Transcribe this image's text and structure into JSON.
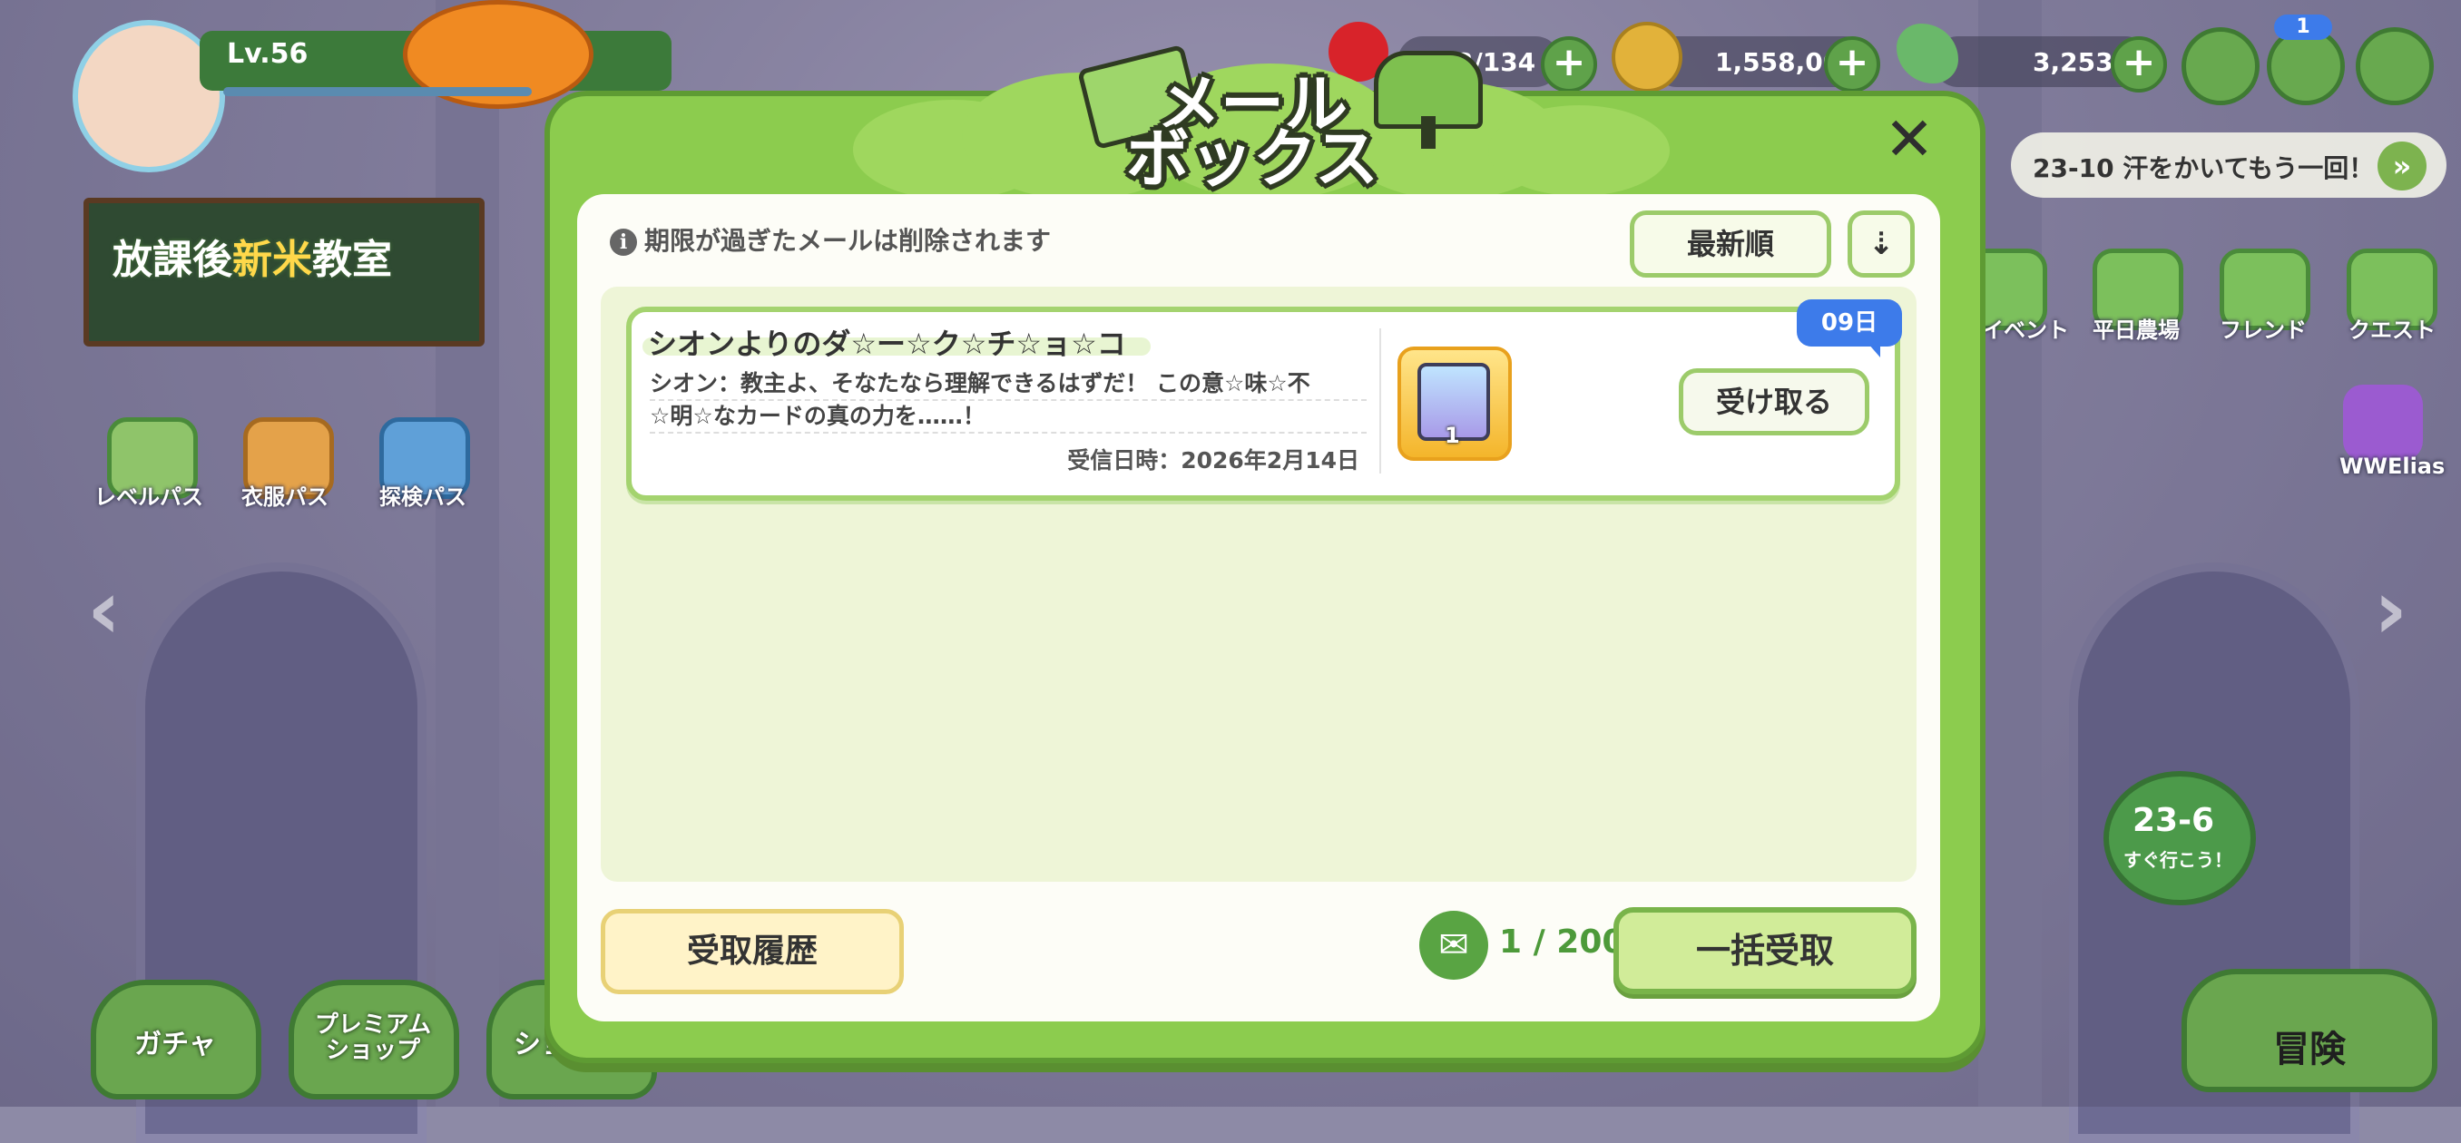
{
  "colors": {
    "modal_frame": "#8ccc4e",
    "modal_inner": "#fdfdf7",
    "accent_green": "#4d9a3a",
    "badge_blue": "#3d7bea"
  },
  "hud": {
    "level": "Lv.56",
    "stamina": "3/134",
    "gold": "1,558,001",
    "leaf_currency": "3,253",
    "notification_count": "1",
    "stage_hint": "23-10 汗をかいてもう一回！",
    "stage_button": "23-6",
    "stage_button_sub": "すぐ行こう！",
    "player_name": "WWElias"
  },
  "banner": {
    "text_a": "放課後",
    "text_b": "新米",
    "text_c": "教室"
  },
  "passes": [
    "レベルパス",
    "衣服パス",
    "探検パス"
  ],
  "side_menu": [
    "イベント",
    "平日農場",
    "フレンド",
    "クエスト"
  ],
  "bottom_nav": {
    "gacha": "ガチャ",
    "premium_shop": "プレミアム\nショップ",
    "shop": "ショ",
    "adventure": "冒険"
  },
  "mailbox": {
    "title_line1": "メール",
    "title_line2": "ボックス",
    "notice": "期限が過ぎたメールは削除されます",
    "sort_label": "最新順",
    "sort_order_icon": "sort-descending-icon",
    "mails": [
      {
        "title": "シオンよりのダ☆ー☆ク☆チ☆ョ☆コ",
        "body_line1": "シオン：教主よ、そなたなら理解できるはずだ！ この意☆味☆不",
        "body_line2": "☆明☆なカードの真の力を……！",
        "received": "受信日時：2026年2月14日",
        "days_left": "09日",
        "reward_qty": "1",
        "receive_label": "受け取る"
      }
    ],
    "history_label": "受取履歴",
    "count": "1 / 200",
    "bulk_receive_label": "一括受取",
    "close_icon": "close-icon"
  }
}
